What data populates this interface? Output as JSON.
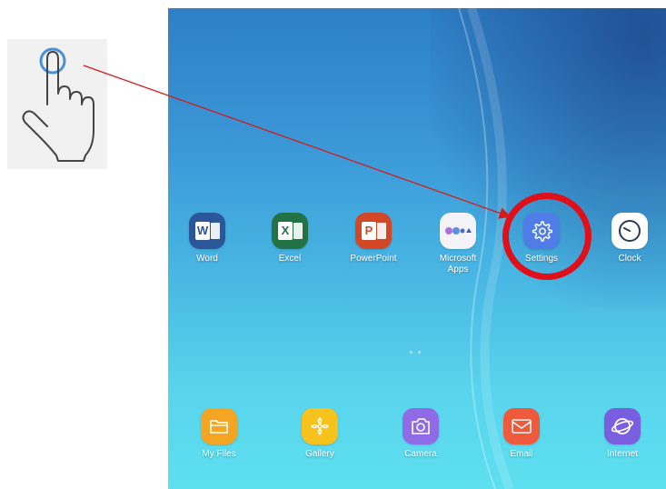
{
  "colors": {
    "highlight": "#e0101a",
    "arrow": "#d91a1a"
  },
  "apps_top": [
    {
      "label": "Word",
      "icon": "word-icon"
    },
    {
      "label": "Excel",
      "icon": "excel-icon"
    },
    {
      "label": "PowerPoint",
      "icon": "powerpoint-icon"
    },
    {
      "label": "Microsoft\nApps",
      "icon": "microsoft-apps-folder-icon"
    },
    {
      "label": "Settings",
      "icon": "gear-icon"
    },
    {
      "label": "Clock",
      "icon": "clock-icon"
    }
  ],
  "apps_dock": [
    {
      "label": "My Files",
      "icon": "folder-icon"
    },
    {
      "label": "Gallery",
      "icon": "gallery-icon"
    },
    {
      "label": "Camera",
      "icon": "camera-icon"
    },
    {
      "label": "Email",
      "icon": "envelope-icon"
    },
    {
      "label": "Internet",
      "icon": "globe-icon"
    }
  ],
  "office_letters": {
    "word": "W",
    "excel": "X",
    "powerpoint": "P"
  }
}
